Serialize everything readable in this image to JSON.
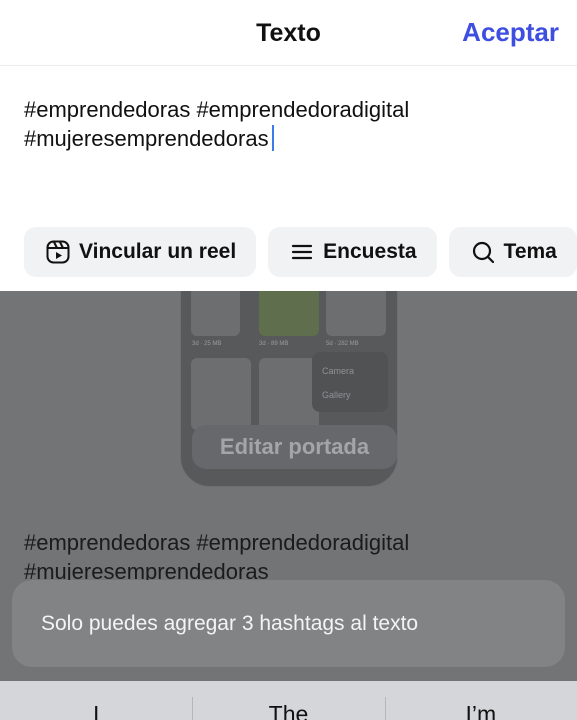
{
  "header": {
    "title": "Texto",
    "accept_label": "Aceptar"
  },
  "composer": {
    "line1": "#emprendedoras #emprendedoradigital",
    "line2": "#mujeresemprendedoras"
  },
  "chips": [
    {
      "label": "Vincular un reel",
      "icon": "reel-icon"
    },
    {
      "label": "Encuesta",
      "icon": "list-icon"
    },
    {
      "label": "Tema",
      "icon": "search-icon"
    }
  ],
  "background": {
    "thumb_meta": [
      "3d · 25 MB",
      "3d · 89 MB",
      "5d · 282 MB"
    ],
    "menu_items": [
      "Camera",
      "Gallery"
    ],
    "edit_cover_label": "Editar portada",
    "caption_line1": "#emprendedoras #emprendedoradigital",
    "caption_line2": "#mujeresemprendedoras"
  },
  "toast": {
    "message": "Solo puedes agregar 3 hashtags al texto"
  },
  "keyboard": {
    "suggestions": [
      "I",
      "The",
      "I’m"
    ]
  },
  "colors": {
    "accent": "#3d4ee0",
    "caret": "#3d7be8",
    "chip_bg": "#f1f2f4",
    "toast_bg": "#828385",
    "keyboard_bg": "#d4d6da"
  }
}
